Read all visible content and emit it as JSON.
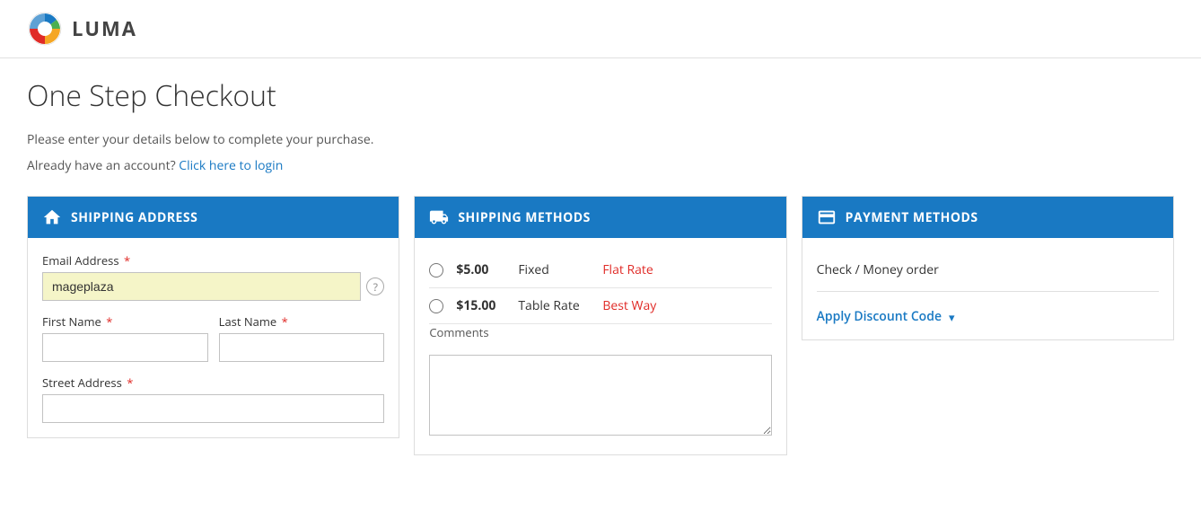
{
  "header": {
    "logo_alt": "Luma",
    "logo_text": "LUMA"
  },
  "page": {
    "title": "One Step Checkout",
    "subtitle": "Please enter your details below to complete your purchase.",
    "login_prompt": "Already have an account?",
    "login_link": "Click here to login"
  },
  "shipping_address": {
    "section_title": "SHIPPING ADDRESS",
    "email_label": "Email Address",
    "email_value": "mageplaza",
    "email_placeholder": "",
    "first_name_label": "First Name",
    "last_name_label": "Last Name",
    "street_address_label": "Street Address"
  },
  "shipping_methods": {
    "section_title": "SHIPPING METHODS",
    "options": [
      {
        "price": "$5.00",
        "type": "Fixed",
        "carrier": "Flat Rate"
      },
      {
        "price": "$15.00",
        "type": "Table Rate",
        "carrier": "Best Way"
      }
    ],
    "comments_label": "Comments",
    "comments_placeholder": ""
  },
  "payment_methods": {
    "section_title": "PAYMENT METHODS",
    "payment_option": "Check / Money order",
    "apply_discount_label": "Apply Discount Code",
    "chevron": "▾"
  }
}
